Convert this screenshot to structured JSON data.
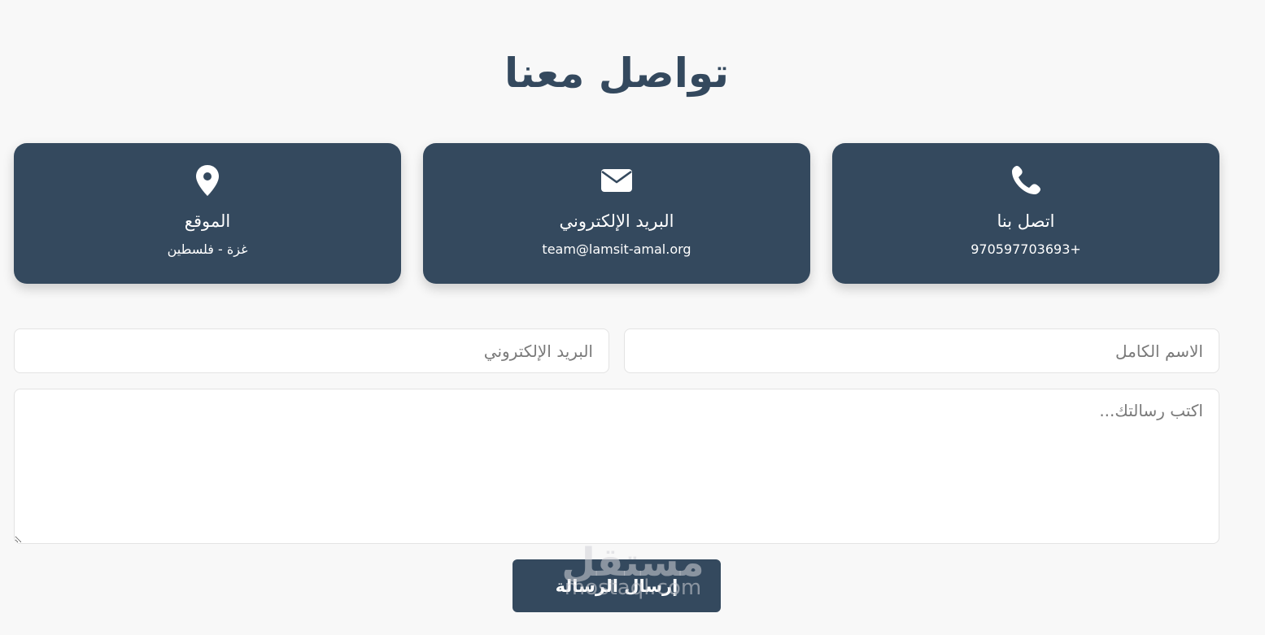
{
  "section": {
    "title": "تواصل معنا"
  },
  "cards": {
    "phone": {
      "icon": "phone-icon",
      "title": "اتصل بنا",
      "value": "970597703693+"
    },
    "email": {
      "icon": "envelope-icon",
      "title": "البريد الإلكتروني",
      "value": "team@lamsit-amal.org"
    },
    "location": {
      "icon": "map-pin-icon",
      "title": "الموقع",
      "value": "غزة - فلسطين"
    }
  },
  "form": {
    "name_placeholder": "الاسم الكامل",
    "email_placeholder": "البريد الإلكتروني",
    "message_placeholder": "اكتب رسالتك...",
    "submit_label": "إرسال الرسالة"
  },
  "watermark": {
    "arabic": "مستقل",
    "latin": "mostaql.com"
  },
  "colors": {
    "accent": "#34495e",
    "background": "#f8f8f8"
  }
}
